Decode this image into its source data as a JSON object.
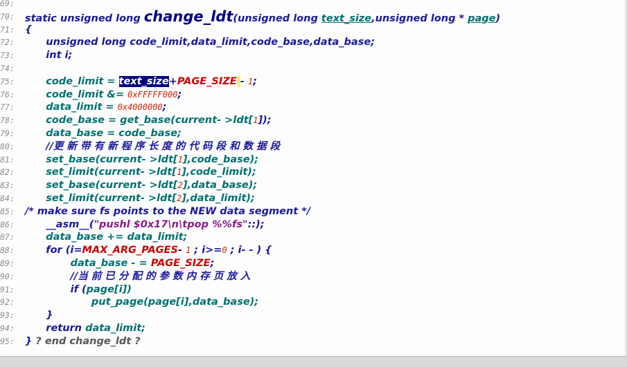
{
  "editor": {
    "lines": [
      {
        "num": "69:",
        "parts": []
      },
      {
        "num": "70:",
        "parts": [
          {
            "t": "static unsigned long ",
            "c": "kw"
          },
          {
            "t": "change_ldt",
            "c": "fn"
          },
          {
            "t": "(unsigned long ",
            "c": "kw"
          },
          {
            "t": "text_size",
            "c": "param"
          },
          {
            "t": ",unsigned long * ",
            "c": "kw"
          },
          {
            "t": "page",
            "c": "param"
          },
          {
            "t": ")",
            "c": "kw"
          }
        ]
      },
      {
        "num": "71:",
        "parts": [
          {
            "t": "{",
            "c": "kw"
          }
        ]
      },
      {
        "num": "72:",
        "parts": [
          {
            "t": "      unsigned long ",
            "c": "kw"
          },
          {
            "t": "code_limit,data_limit,code_base,data_base;",
            "c": "op"
          }
        ]
      },
      {
        "num": "73:",
        "parts": [
          {
            "t": "      int i;",
            "c": "kw"
          }
        ]
      },
      {
        "num": "74:",
        "parts": []
      },
      {
        "num": "75:",
        "parts": [
          {
            "t": "      code_limit = ",
            "c": "pl"
          },
          {
            "t": "text_size",
            "c": "sel"
          },
          {
            "t": "+",
            "c": "op"
          },
          {
            "t": "PAGE_SIZE",
            "c": "mac"
          },
          {
            "t": " ",
            "c": "cursor"
          },
          {
            "t": "- ",
            "c": "op"
          },
          {
            "t": "1",
            "c": "num"
          },
          {
            "t": ";",
            "c": "op"
          }
        ]
      },
      {
        "num": "76:",
        "parts": [
          {
            "t": "      code_limit &= ",
            "c": "pl"
          },
          {
            "t": "0xFFFFF000",
            "c": "num"
          },
          {
            "t": ";",
            "c": "op"
          }
        ]
      },
      {
        "num": "77:",
        "parts": [
          {
            "t": "      data_limit = ",
            "c": "pl"
          },
          {
            "t": "0x4000000",
            "c": "num"
          },
          {
            "t": ";",
            "c": "op"
          }
        ]
      },
      {
        "num": "78:",
        "parts": [
          {
            "t": "      code_base = get_base(current- >ldt[",
            "c": "pl"
          },
          {
            "t": "1",
            "c": "num"
          },
          {
            "t": "]);",
            "c": "op"
          }
        ]
      },
      {
        "num": "79:",
        "parts": [
          {
            "t": "      data_base = code_base;",
            "c": "pl"
          }
        ]
      },
      {
        "num": "80:",
        "parts": [
          {
            "t": "      //更 新 带 有 新 程 序 长 度 的 代 码 段 和 数 据 段",
            "c": "cm"
          }
        ]
      },
      {
        "num": "81:",
        "parts": [
          {
            "t": "      set_base(current- >ldt[",
            "c": "pl"
          },
          {
            "t": "1",
            "c": "num"
          },
          {
            "t": "],code_base);",
            "c": "pl"
          }
        ]
      },
      {
        "num": "82:",
        "parts": [
          {
            "t": "      set_limit(current- >ldt[",
            "c": "pl"
          },
          {
            "t": "1",
            "c": "num"
          },
          {
            "t": "],code_limit);",
            "c": "pl"
          }
        ]
      },
      {
        "num": "83:",
        "parts": [
          {
            "t": "      set_base(current- >ldt[",
            "c": "pl"
          },
          {
            "t": "2",
            "c": "num"
          },
          {
            "t": "],data_base);",
            "c": "pl"
          }
        ]
      },
      {
        "num": "84:",
        "parts": [
          {
            "t": "      set_limit(current- >ldt[",
            "c": "pl"
          },
          {
            "t": "2",
            "c": "num"
          },
          {
            "t": "],data_limit);",
            "c": "pl"
          }
        ]
      },
      {
        "num": "85:",
        "parts": [
          {
            "t": "/* make sure fs points to the NEW data segment */",
            "c": "cm"
          }
        ]
      },
      {
        "num": "86:",
        "parts": [
          {
            "t": "      __asm__(",
            "c": "kw"
          },
          {
            "t": "\"pushl $0x17\\n\\tpop %%fs\"",
            "c": "str"
          },
          {
            "t": "::);",
            "c": "kw"
          }
        ]
      },
      {
        "num": "87:",
        "parts": [
          {
            "t": "      data_base += data_limit;",
            "c": "pl"
          }
        ]
      },
      {
        "num": "88:",
        "parts": [
          {
            "t": "      for (i=",
            "c": "kw"
          },
          {
            "t": "MAX_ARG_PAGES",
            "c": "mac"
          },
          {
            "t": "- ",
            "c": "op"
          },
          {
            "t": "1",
            "c": "num"
          },
          {
            "t": " ; i>=",
            "c": "op"
          },
          {
            "t": "0",
            "c": "num"
          },
          {
            "t": " ; i- - ) {",
            "c": "op"
          }
        ]
      },
      {
        "num": "89:",
        "parts": [
          {
            "t": "             data_base - = ",
            "c": "pl"
          },
          {
            "t": "PAGE_SIZE",
            "c": "mac"
          },
          {
            "t": ";",
            "c": "op"
          }
        ]
      },
      {
        "num": "90:",
        "parts": [
          {
            "t": "             //当 前 已 分 配 的 参 数 内 存 页 放 入",
            "c": "cm"
          }
        ]
      },
      {
        "num": "91:",
        "parts": [
          {
            "t": "             if (",
            "c": "kw"
          },
          {
            "t": "page[i])",
            "c": "pl"
          }
        ]
      },
      {
        "num": "92:",
        "parts": [
          {
            "t": "                   put_page(page[i],data_base);",
            "c": "pl"
          }
        ]
      },
      {
        "num": "93:",
        "parts": [
          {
            "t": "      }",
            "c": "kw"
          }
        ]
      },
      {
        "num": "94:",
        "parts": [
          {
            "t": "      return ",
            "c": "kw"
          },
          {
            "t": "data_limit;",
            "c": "pl"
          }
        ]
      },
      {
        "num": "95:",
        "parts": [
          {
            "t": "} ",
            "c": "kw"
          },
          {
            "t": "? end change_ldt ?",
            "c": "gray"
          }
        ]
      }
    ]
  }
}
